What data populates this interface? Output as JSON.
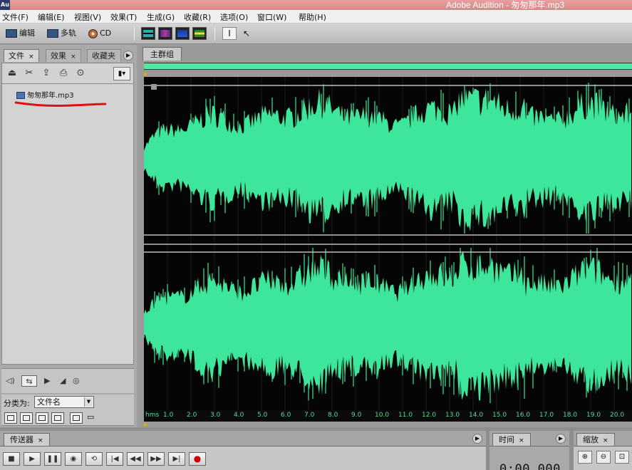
{
  "window": {
    "title": "Adobe Audition - 匆匆那年.mp3",
    "app_icon": "Au"
  },
  "menu": [
    "文件(F)",
    "编辑(E)",
    "视图(V)",
    "效果(T)",
    "生成(G)",
    "收藏(R)",
    "选项(O)",
    "窗口(W)",
    "帮助(H)"
  ],
  "toolbar": {
    "modes": [
      {
        "label": "编辑",
        "icon": "edit-view-icon"
      },
      {
        "label": "多轨",
        "icon": "multitrack-view-icon"
      },
      {
        "label": "CD",
        "icon": "cd-view-icon"
      }
    ],
    "view_icons": [
      "waveform-view-icon",
      "spectral-view-icon",
      "spectral-pan-icon",
      "phase-view-icon"
    ],
    "tool_icons": [
      "time-selection-tool-icon",
      "scrub-tool-icon"
    ]
  },
  "files_panel": {
    "tabs": [
      {
        "label": "文件",
        "close": "×"
      },
      {
        "label": "效果",
        "close": "×"
      },
      {
        "label": "收藏夹",
        "close": ""
      }
    ],
    "files": [
      {
        "name": "匆匆那年.mp3",
        "icon": "audio-file-icon"
      }
    ],
    "sort_label": "分类为:",
    "sort_value": "文件名"
  },
  "editor": {
    "tab_label": "主群组",
    "ruler_unit": "hms",
    "ruler_ticks": [
      "1.0",
      "2.0",
      "3.0",
      "4.0",
      "5.0",
      "6.0",
      "7.0",
      "8.0",
      "9.0",
      "10.0",
      "11.0",
      "12.0",
      "13.0",
      "14.0",
      "15.0",
      "16.0",
      "17.0",
      "18.0",
      "19.0",
      "20.0"
    ]
  },
  "colors": {
    "waveform": "#3de69a",
    "background": "#050505",
    "center_line": "#bdbdbd",
    "annotation": "#e01010"
  },
  "transport": {
    "tab_label": "传送器",
    "close": "×"
  },
  "time_panel": {
    "tab_label": "时间",
    "close": "×",
    "value": "0:00.000"
  },
  "zoom_panel": {
    "tab_label": "缩放",
    "close": "×"
  }
}
